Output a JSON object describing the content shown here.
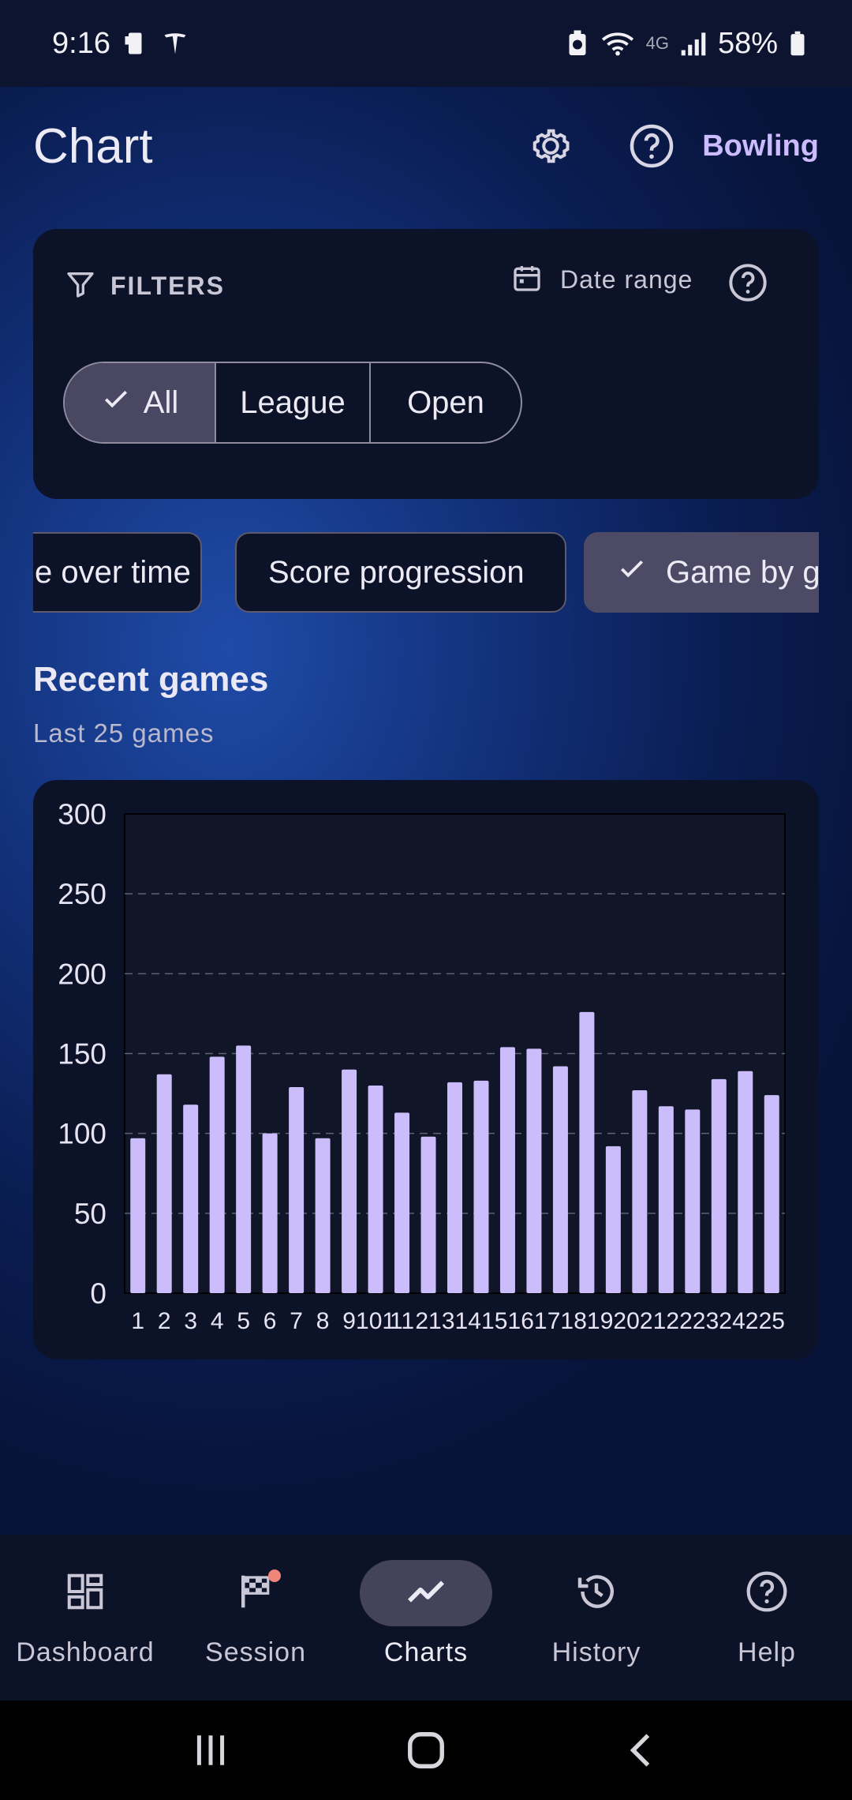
{
  "status_bar": {
    "time": "9:16",
    "battery": "58%",
    "network": "4G"
  },
  "app_bar": {
    "title": "Chart",
    "link": "Bowling",
    "icons": [
      "settings-icon",
      "help-icon"
    ]
  },
  "filters": {
    "label": "FILTERS",
    "date_range": "Date range",
    "segments": [
      {
        "label": "All",
        "selected": true
      },
      {
        "label": "League",
        "selected": false
      },
      {
        "label": "Open",
        "selected": false
      }
    ]
  },
  "chart_tabs": [
    {
      "label": "e over time",
      "selected": false
    },
    {
      "label": "Score progression",
      "selected": false
    },
    {
      "label": "Game by ga",
      "selected": true
    }
  ],
  "section": {
    "title": "Recent games",
    "subtitle": "Last 25 games"
  },
  "colors": {
    "bar": "#cbbdfb",
    "accent": "#cdbbff",
    "card": "#0c1227",
    "background": "#0a1d52"
  },
  "chart_data": {
    "type": "bar",
    "categories": [
      "1",
      "2",
      "3",
      "4",
      "5",
      "6",
      "7",
      "8",
      "9",
      "10",
      "11",
      "12",
      "13",
      "14",
      "15",
      "16",
      "17",
      "18",
      "19",
      "20",
      "21",
      "22",
      "23",
      "24",
      "25"
    ],
    "tick_labels": [
      "1",
      "2",
      "3",
      "4",
      "5",
      "6",
      "7",
      "8",
      "9",
      "101",
      "11",
      "21",
      "31",
      "41",
      "51",
      "61",
      "71",
      "81",
      "92",
      "02",
      "12",
      "22",
      "32",
      "42",
      "25"
    ],
    "values": [
      97,
      137,
      118,
      148,
      155,
      100,
      129,
      97,
      140,
      130,
      113,
      98,
      132,
      133,
      154,
      153,
      142,
      176,
      92,
      127,
      117,
      115,
      134,
      139,
      124
    ],
    "ylim": [
      0,
      300
    ],
    "yticks": [
      "0",
      "50",
      "100",
      "150",
      "200",
      "250",
      "300"
    ],
    "grid": "dashed horizontal",
    "title": "",
    "xlabel": "",
    "ylabel": ""
  },
  "bottom_nav": [
    {
      "label": "Dashboard",
      "icon": "dashboard-icon",
      "active": false
    },
    {
      "label": "Session",
      "icon": "checkered-flag-icon",
      "active": false
    },
    {
      "label": "Charts",
      "icon": "trending-icon",
      "active": true
    },
    {
      "label": "History",
      "icon": "history-icon",
      "active": false
    },
    {
      "label": "Help",
      "icon": "help-icon",
      "active": false
    }
  ]
}
